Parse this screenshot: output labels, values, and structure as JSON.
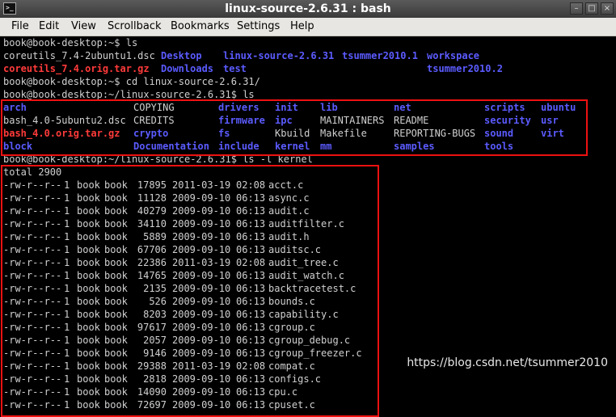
{
  "window": {
    "title": "linux-source-2.6.31 : bash"
  },
  "menu": [
    "File",
    "Edit",
    "View",
    "Scrollback",
    "Bookmarks",
    "Settings",
    "Help"
  ],
  "prompts": {
    "ls1": "book@book-desktop:~$ ls",
    "cd": "book@book-desktop:~$ cd linux-source-2.6.31/",
    "ls2": "book@book-desktop:~/linux-source-2.6.31$ ls",
    "lsk": "book@book-desktop:~/linux-source-2.6.31$ ls -l kernel"
  },
  "home_listing": [
    [
      {
        "name": "coreutils_7.4-2ubuntu1.dsc",
        "kind": "file"
      },
      {
        "name": "Desktop",
        "kind": "dir"
      },
      {
        "name": "linux-source-2.6.31",
        "kind": "dir"
      },
      {
        "name": "tsummer2010.1",
        "kind": "dir"
      },
      {
        "name": "workspace",
        "kind": "dir"
      }
    ],
    [
      {
        "name": "coreutils_7.4.orig.tar.gz",
        "kind": "archive"
      },
      {
        "name": "Downloads",
        "kind": "dir"
      },
      {
        "name": "test",
        "kind": "dir"
      },
      {
        "name": "",
        "kind": "file"
      },
      {
        "name": "tsummer2010.2",
        "kind": "dir"
      }
    ]
  ],
  "source_listing": [
    [
      {
        "name": "arch",
        "kind": "dir"
      },
      {
        "name": "COPYING",
        "kind": "file"
      },
      {
        "name": "drivers",
        "kind": "dir"
      },
      {
        "name": "init",
        "kind": "dir"
      },
      {
        "name": "lib",
        "kind": "dir"
      },
      {
        "name": "net",
        "kind": "dir"
      },
      {
        "name": "scripts",
        "kind": "dir"
      },
      {
        "name": "ubuntu",
        "kind": "dir"
      }
    ],
    [
      {
        "name": "bash_4.0-5ubuntu2.dsc",
        "kind": "file"
      },
      {
        "name": "CREDITS",
        "kind": "file"
      },
      {
        "name": "firmware",
        "kind": "dir"
      },
      {
        "name": "ipc",
        "kind": "dir"
      },
      {
        "name": "MAINTAINERS",
        "kind": "file"
      },
      {
        "name": "README",
        "kind": "file"
      },
      {
        "name": "security",
        "kind": "dir"
      },
      {
        "name": "usr",
        "kind": "dir"
      }
    ],
    [
      {
        "name": "bash_4.0.orig.tar.gz",
        "kind": "archive"
      },
      {
        "name": "crypto",
        "kind": "dir"
      },
      {
        "name": "fs",
        "kind": "dir"
      },
      {
        "name": "Kbuild",
        "kind": "file"
      },
      {
        "name": "Makefile",
        "kind": "file"
      },
      {
        "name": "REPORTING-BUGS",
        "kind": "file"
      },
      {
        "name": "sound",
        "kind": "dir"
      },
      {
        "name": "virt",
        "kind": "dir"
      }
    ],
    [
      {
        "name": "block",
        "kind": "dir"
      },
      {
        "name": "Documentation",
        "kind": "dir"
      },
      {
        "name": "include",
        "kind": "dir"
      },
      {
        "name": "kernel",
        "kind": "dir"
      },
      {
        "name": "mm",
        "kind": "dir"
      },
      {
        "name": "samples",
        "kind": "dir"
      },
      {
        "name": "tools",
        "kind": "dir"
      },
      {
        "name": "",
        "kind": "file"
      }
    ]
  ],
  "kernel_total": "total 2900",
  "kernel_listing": [
    {
      "perm": "-rw-r--r--",
      "links": "1",
      "owner": "book",
      "group": "book",
      "size": "17895",
      "date": "2011-03-19",
      "time": "02:08",
      "name": "acct.c"
    },
    {
      "perm": "-rw-r--r--",
      "links": "1",
      "owner": "book",
      "group": "book",
      "size": "11128",
      "date": "2009-09-10",
      "time": "06:13",
      "name": "async.c"
    },
    {
      "perm": "-rw-r--r--",
      "links": "1",
      "owner": "book",
      "group": "book",
      "size": "40279",
      "date": "2009-09-10",
      "time": "06:13",
      "name": "audit.c"
    },
    {
      "perm": "-rw-r--r--",
      "links": "1",
      "owner": "book",
      "group": "book",
      "size": "34110",
      "date": "2009-09-10",
      "time": "06:13",
      "name": "auditfilter.c"
    },
    {
      "perm": "-rw-r--r--",
      "links": "1",
      "owner": "book",
      "group": "book",
      "size": "5889",
      "date": "2009-09-10",
      "time": "06:13",
      "name": "audit.h"
    },
    {
      "perm": "-rw-r--r--",
      "links": "1",
      "owner": "book",
      "group": "book",
      "size": "67706",
      "date": "2009-09-10",
      "time": "06:13",
      "name": "auditsc.c"
    },
    {
      "perm": "-rw-r--r--",
      "links": "1",
      "owner": "book",
      "group": "book",
      "size": "22386",
      "date": "2011-03-19",
      "time": "02:08",
      "name": "audit_tree.c"
    },
    {
      "perm": "-rw-r--r--",
      "links": "1",
      "owner": "book",
      "group": "book",
      "size": "14765",
      "date": "2009-09-10",
      "time": "06:13",
      "name": "audit_watch.c"
    },
    {
      "perm": "-rw-r--r--",
      "links": "1",
      "owner": "book",
      "group": "book",
      "size": "2135",
      "date": "2009-09-10",
      "time": "06:13",
      "name": "backtracetest.c"
    },
    {
      "perm": "-rw-r--r--",
      "links": "1",
      "owner": "book",
      "group": "book",
      "size": "526",
      "date": "2009-09-10",
      "time": "06:13",
      "name": "bounds.c"
    },
    {
      "perm": "-rw-r--r--",
      "links": "1",
      "owner": "book",
      "group": "book",
      "size": "8203",
      "date": "2009-09-10",
      "time": "06:13",
      "name": "capability.c"
    },
    {
      "perm": "-rw-r--r--",
      "links": "1",
      "owner": "book",
      "group": "book",
      "size": "97617",
      "date": "2009-09-10",
      "time": "06:13",
      "name": "cgroup.c"
    },
    {
      "perm": "-rw-r--r--",
      "links": "1",
      "owner": "book",
      "group": "book",
      "size": "2057",
      "date": "2009-09-10",
      "time": "06:13",
      "name": "cgroup_debug.c"
    },
    {
      "perm": "-rw-r--r--",
      "links": "1",
      "owner": "book",
      "group": "book",
      "size": "9146",
      "date": "2009-09-10",
      "time": "06:13",
      "name": "cgroup_freezer.c"
    },
    {
      "perm": "-rw-r--r--",
      "links": "1",
      "owner": "book",
      "group": "book",
      "size": "29388",
      "date": "2011-03-19",
      "time": "02:08",
      "name": "compat.c"
    },
    {
      "perm": "-rw-r--r--",
      "links": "1",
      "owner": "book",
      "group": "book",
      "size": "2818",
      "date": "2009-09-10",
      "time": "06:13",
      "name": "configs.c"
    },
    {
      "perm": "-rw-r--r--",
      "links": "1",
      "owner": "book",
      "group": "book",
      "size": "14090",
      "date": "2009-09-10",
      "time": "06:13",
      "name": "cpu.c"
    },
    {
      "perm": "-rw-r--r--",
      "links": "1",
      "owner": "book",
      "group": "book",
      "size": "72697",
      "date": "2009-09-10",
      "time": "06:13",
      "name": "cpuset.c"
    }
  ],
  "watermark": "https://blog.csdn.net/tsummer2010",
  "colors": {
    "directory": "#5b5bff",
    "archive": "#ff3a3a",
    "plain": "#d0d0d0",
    "highlight": "#ee1111"
  }
}
